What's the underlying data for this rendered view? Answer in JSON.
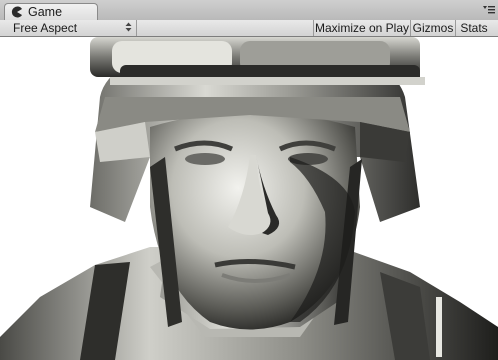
{
  "tab": {
    "label": "Game",
    "icon": "pacman-icon"
  },
  "window_menu": {
    "icon": "panel-menu-icon"
  },
  "toolbar": {
    "aspect_value": "Free Aspect",
    "maximize_label": "Maximize on Play",
    "gizmos_label": "Gizmos",
    "stats_label": "Stats"
  },
  "viewport": {
    "content": "soldier-head-render"
  }
}
